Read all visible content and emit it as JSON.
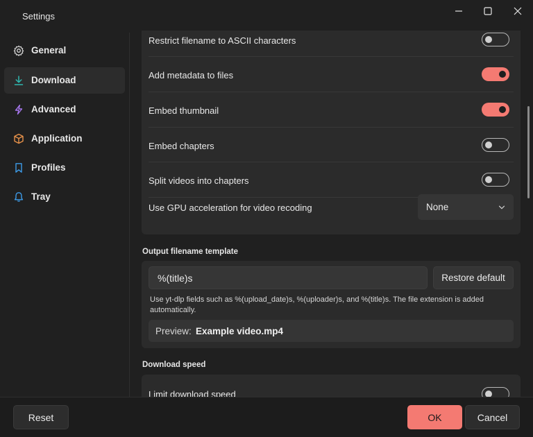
{
  "window": {
    "title": "Settings"
  },
  "sidebar": {
    "items": [
      {
        "label": "General",
        "icon": "gear-icon",
        "active": false
      },
      {
        "label": "Download",
        "icon": "download-icon",
        "active": true
      },
      {
        "label": "Advanced",
        "icon": "lightning-icon",
        "active": false
      },
      {
        "label": "Application",
        "icon": "box-icon",
        "active": false
      },
      {
        "label": "Profiles",
        "icon": "bookmark-icon",
        "active": false
      },
      {
        "label": "Tray",
        "icon": "bell-icon",
        "active": false
      }
    ]
  },
  "download": {
    "options": [
      {
        "label": "Restrict filename to ASCII characters",
        "enabled": false
      },
      {
        "label": "Add metadata to files",
        "enabled": true
      },
      {
        "label": "Embed thumbnail",
        "enabled": true
      },
      {
        "label": "Embed chapters",
        "enabled": false
      },
      {
        "label": "Split videos into chapters",
        "enabled": false
      }
    ],
    "gpu": {
      "label": "Use GPU acceleration for video recoding",
      "value": "None"
    },
    "template": {
      "title": "Output filename template",
      "value": "%(title)s",
      "restore_label": "Restore default",
      "hint": "Use yt-dlp fields such as %(upload_date)s, %(uploader)s, and %(title)s. The file extension is added automatically.",
      "preview_label": "Preview:",
      "preview_value": "Example video.mp4"
    },
    "speed": {
      "title": "Download speed",
      "limit_label": "Limit download speed",
      "enabled": false
    }
  },
  "footer": {
    "reset_label": "Reset",
    "ok_label": "OK",
    "cancel_label": "Cancel"
  },
  "colors": {
    "accent": "#f47a72",
    "background": "#202020",
    "card": "#2b2b2b"
  }
}
